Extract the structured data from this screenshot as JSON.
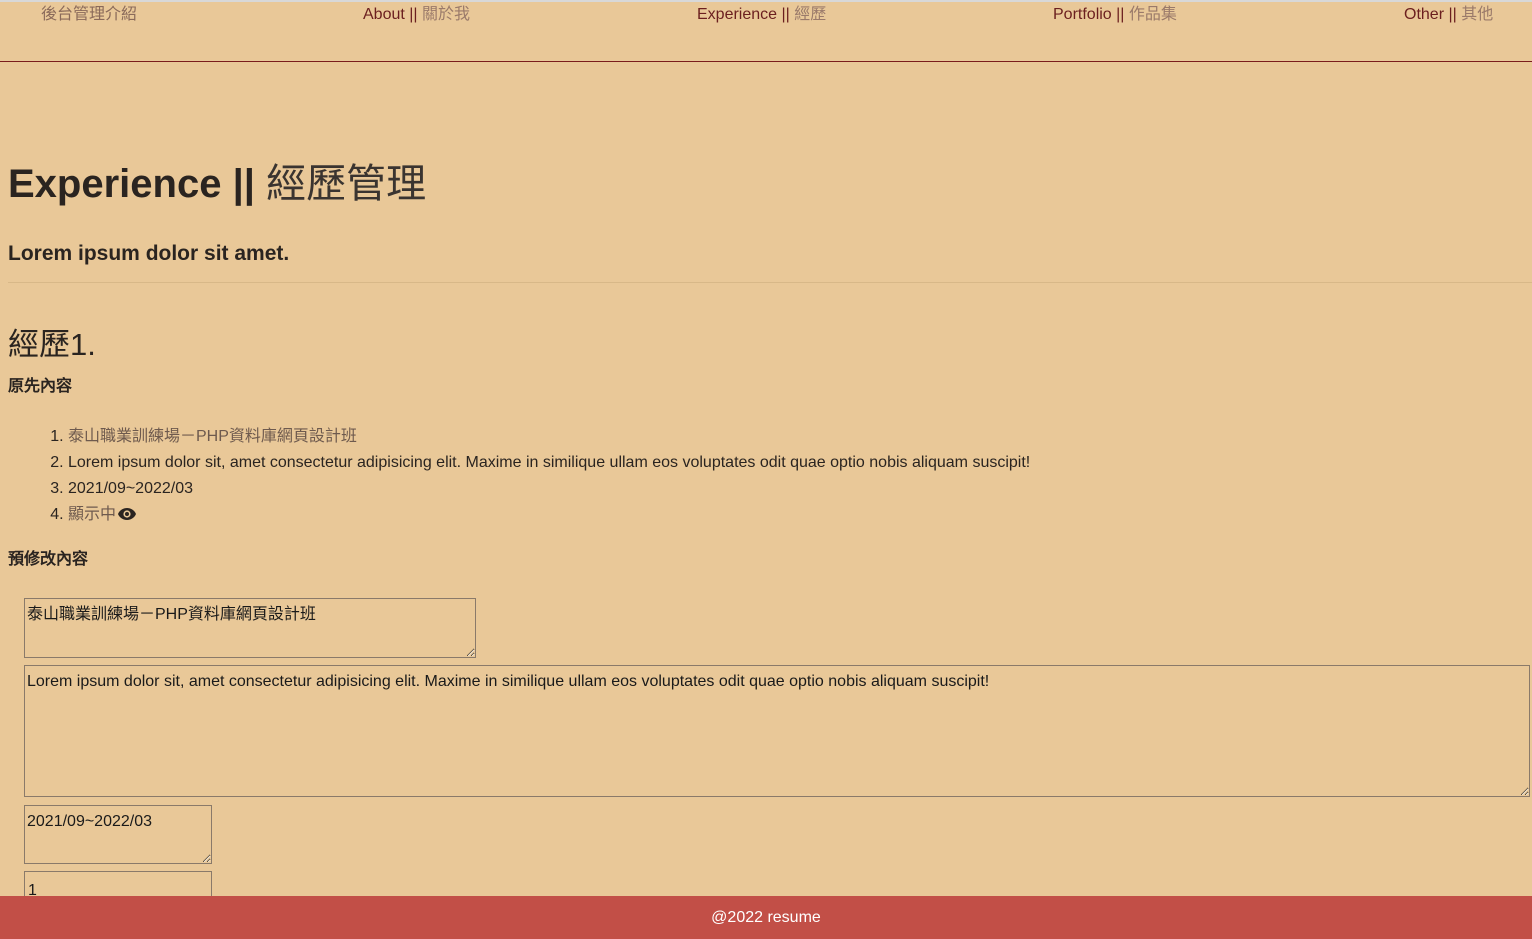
{
  "nav": {
    "home": "後台管理介紹",
    "items": [
      {
        "en": "About",
        "sep": " || ",
        "zh": "關於我"
      },
      {
        "en": "Experience",
        "sep": " || ",
        "zh": "經歷"
      },
      {
        "en": "Portfolio",
        "sep": " || ",
        "zh": "作品集"
      },
      {
        "en": "Other",
        "sep": " || ",
        "zh": "其他"
      }
    ]
  },
  "header": {
    "title_en": "Experience || ",
    "title_zh": "經歷管理",
    "subtitle": "Lorem ipsum dolor sit amet."
  },
  "experience": {
    "heading": "經歷1.",
    "original_label": "原先內容",
    "original_items": [
      "泰山職業訓練場－PHP資料庫網頁設計班",
      "Lorem ipsum dolor sit, amet consectetur adipisicing elit. Maxime in similique ullam eos voluptates odit quae optio nobis aliquam suscipit!",
      "2021/09~2022/03",
      "顯示中"
    ],
    "edit_label": "預修改內容",
    "edit_fields": {
      "title": "泰山職業訓練場－PHP資料庫網頁設計班",
      "description": "Lorem ipsum dolor sit, amet consectetur adipisicing elit. Maxime in similique ullam eos voluptates odit quae optio nobis aliquam suscipit!",
      "period": "2021/09~2022/03",
      "display": "1"
    }
  },
  "icons": {
    "visible": "eye-icon"
  },
  "footer": {
    "text": "@2022 resume"
  },
  "colors": {
    "background": "#e9c898",
    "footer": "#c24f47",
    "nav_accent": "#6b1f1f"
  }
}
